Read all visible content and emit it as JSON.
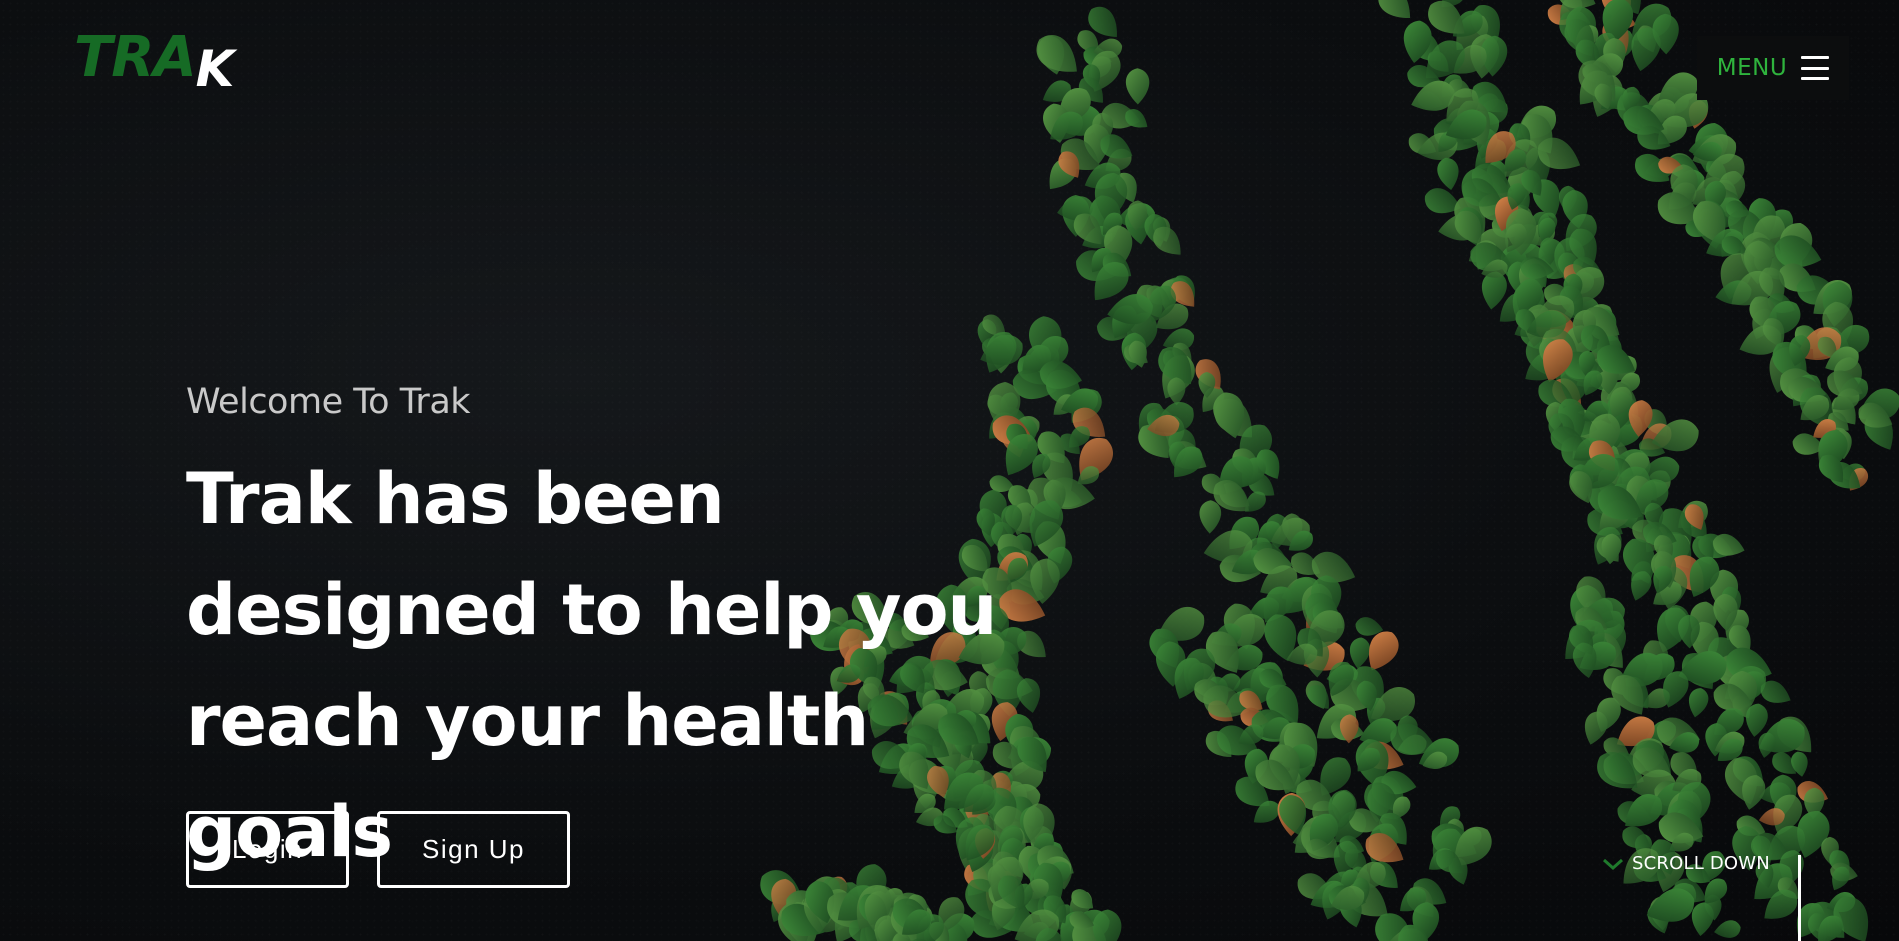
{
  "logo": {
    "green_text": "TRA",
    "white_text": "K"
  },
  "menu": {
    "label": "MENU",
    "icon": "hamburger-icon"
  },
  "hero": {
    "welcome": "Welcome To Trak",
    "headline": "Trak has been designed to help you reach your health goals"
  },
  "buttons": {
    "login": "Login",
    "signup": "Sign Up"
  },
  "scroll": {
    "label": "SCROLL DOWN",
    "icon": "chevron-down-icon"
  },
  "colors": {
    "accent_green": "#2fb33d",
    "logo_green": "#166b25",
    "background": "#0b0d0f",
    "text": "#ffffff"
  }
}
